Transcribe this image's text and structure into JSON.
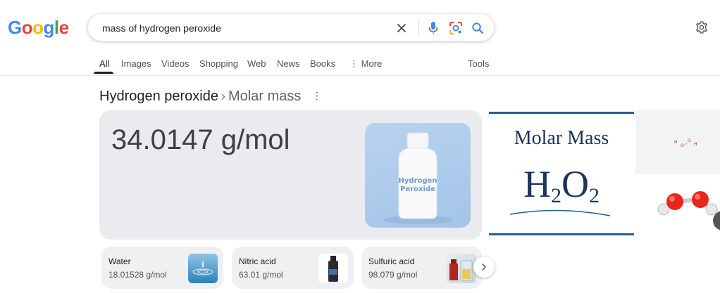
{
  "logo": {
    "letters": [
      "G",
      "o",
      "o",
      "g",
      "l",
      "e"
    ],
    "colors": [
      "#4285F4",
      "#EA4335",
      "#FBBC05",
      "#4285F4",
      "#34A853",
      "#EA4335"
    ]
  },
  "search": {
    "query": "mass of hydrogen peroxide",
    "icons": [
      "close-icon",
      "mic-icon",
      "lens-icon",
      "search-icon"
    ]
  },
  "settings": {
    "icon": "gear-icon"
  },
  "tabs": [
    {
      "label": "All",
      "active": true
    },
    {
      "label": "Images"
    },
    {
      "label": "Videos"
    },
    {
      "label": "Shopping"
    },
    {
      "label": "Web"
    },
    {
      "label": "News"
    },
    {
      "label": "Books"
    },
    {
      "label": "More"
    }
  ],
  "tools_label": "Tools",
  "result": {
    "entity": "Hydrogen peroxide",
    "separator": "›",
    "attribute": "Molar mass",
    "value": "34.0147 g/mol",
    "bottle_text": [
      "Hydrogen",
      "Peroxide"
    ]
  },
  "molar_image": {
    "title": "Molar Mass",
    "formula_parts": [
      "H",
      "2",
      "O",
      "2"
    ]
  },
  "structure_image": {
    "labels": [
      "H",
      "O",
      "O",
      "H"
    ]
  },
  "related": [
    {
      "name": "Water",
      "value": "18.01528 g/mol"
    },
    {
      "name": "Nitric acid",
      "value": "63.01 g/mol"
    },
    {
      "name": "Sulfuric acid",
      "value": "98.079 g/mol"
    }
  ],
  "colors": {
    "accent_blue": "#4285F4",
    "text_primary": "#202124",
    "card_bg": "#e9ebee"
  }
}
